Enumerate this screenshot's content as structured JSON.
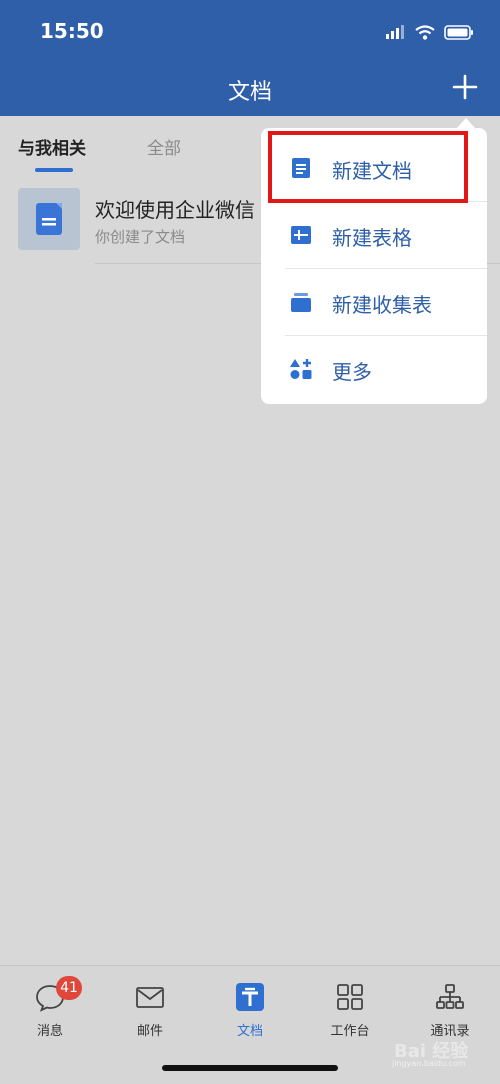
{
  "status": {
    "time": "15:50",
    "icons": [
      "signal-icon",
      "wifi-icon",
      "battery-icon"
    ]
  },
  "header": {
    "title": "文档",
    "add_icon": "plus-icon"
  },
  "tabs": [
    {
      "label": "与我相关",
      "active": true
    },
    {
      "label": "全部",
      "active": false
    }
  ],
  "documents": [
    {
      "title": "欢迎使用企业微信",
      "subtitle": "你创建了文档",
      "icon": "doc-icon"
    }
  ],
  "menu": {
    "items": [
      {
        "label": "新建文档",
        "icon": "document-icon",
        "highlighted": true
      },
      {
        "label": "新建表格",
        "icon": "table-icon"
      },
      {
        "label": "新建收集表",
        "icon": "collection-form-icon"
      },
      {
        "label": "更多",
        "icon": "shapes-icon"
      }
    ]
  },
  "bottom_nav": {
    "items": [
      {
        "label": "消息",
        "icon": "chat-icon",
        "badge": "41"
      },
      {
        "label": "邮件",
        "icon": "mail-icon"
      },
      {
        "label": "文档",
        "icon": "docs-icon",
        "active": true
      },
      {
        "label": "工作台",
        "icon": "grid-icon"
      },
      {
        "label": "通讯录",
        "icon": "org-chart-icon"
      }
    ]
  },
  "watermark": {
    "text": "Bai 经验",
    "url": "jingyan.baidu.com"
  },
  "colors": {
    "header": "#2e5fa8",
    "accent": "#2e6fd0",
    "badge": "#e0473b",
    "highlight": "#e01818"
  }
}
